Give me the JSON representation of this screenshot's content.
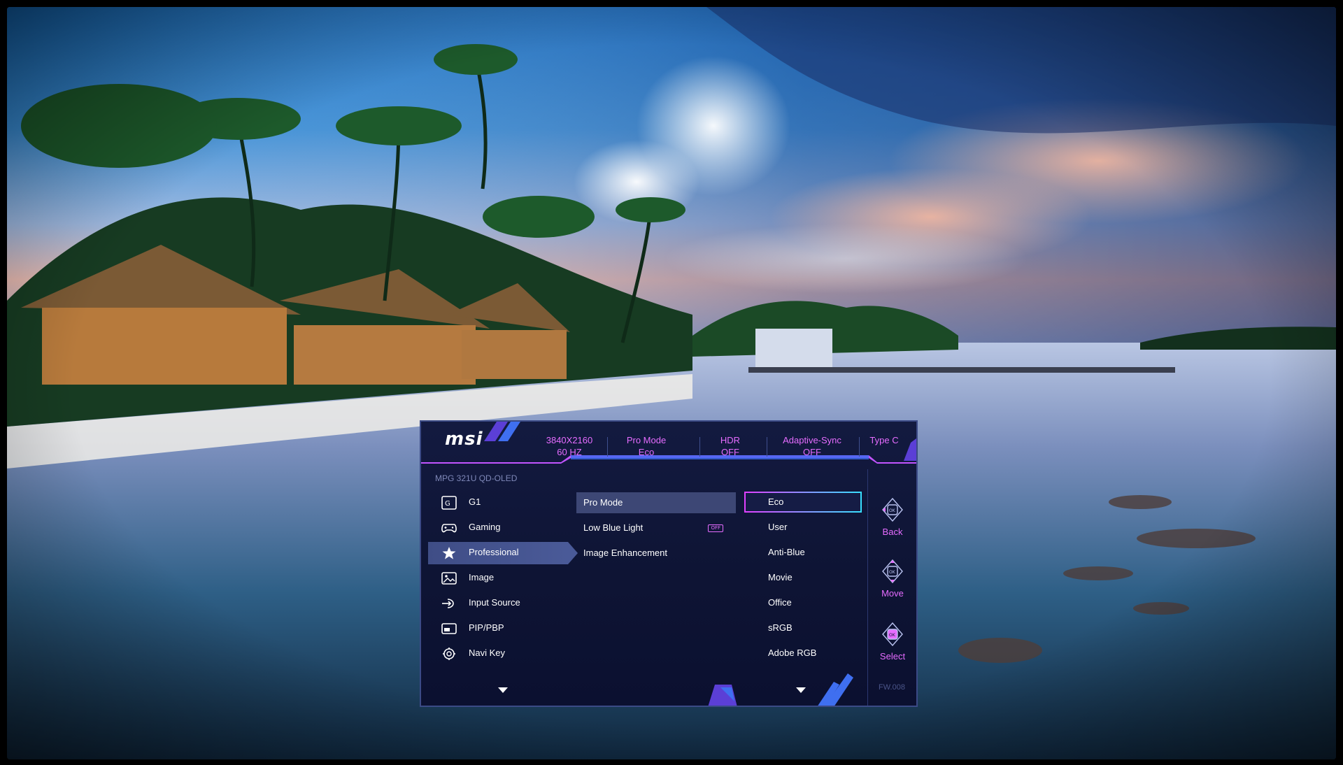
{
  "osd": {
    "logo": "msi",
    "model": "MPG 321U QD-OLED",
    "firmware": "FW.008",
    "status": [
      {
        "line1": "3840X2160",
        "line2": "60 HZ"
      },
      {
        "line1": "Pro Mode",
        "line2": "Eco"
      },
      {
        "line1": "HDR",
        "line2": "OFF"
      },
      {
        "line1": "Adaptive-Sync",
        "line2": "OFF"
      },
      {
        "line1": "Type C",
        "line2": ""
      }
    ],
    "menu": [
      {
        "label": "G1",
        "icon": "g1-icon"
      },
      {
        "label": "Gaming",
        "icon": "gamepad-icon"
      },
      {
        "label": "Professional",
        "icon": "star-icon"
      },
      {
        "label": "Image",
        "icon": "image-icon"
      },
      {
        "label": "Input Source",
        "icon": "input-source-icon"
      },
      {
        "label": "PIP/PBP",
        "icon": "pip-icon"
      },
      {
        "label": "Navi Key",
        "icon": "navi-key-icon"
      }
    ],
    "submenu": [
      {
        "label": "Pro Mode"
      },
      {
        "label": "Low Blue Light",
        "badge": "OFF"
      },
      {
        "label": "Image Enhancement"
      }
    ],
    "options": [
      "Eco",
      "User",
      "Anti-Blue",
      "Movie",
      "Office",
      "sRGB",
      "Adobe RGB"
    ],
    "nav": [
      {
        "label": "Back",
        "key": "OK"
      },
      {
        "label": "Move",
        "key": "OK"
      },
      {
        "label": "Select",
        "key": "OK"
      }
    ],
    "colors": {
      "accent_magenta": "#e66cff",
      "accent_cyan": "#38e0ff",
      "panel_bg": "#0e1434",
      "selection_bg": "#4a5a98"
    }
  }
}
